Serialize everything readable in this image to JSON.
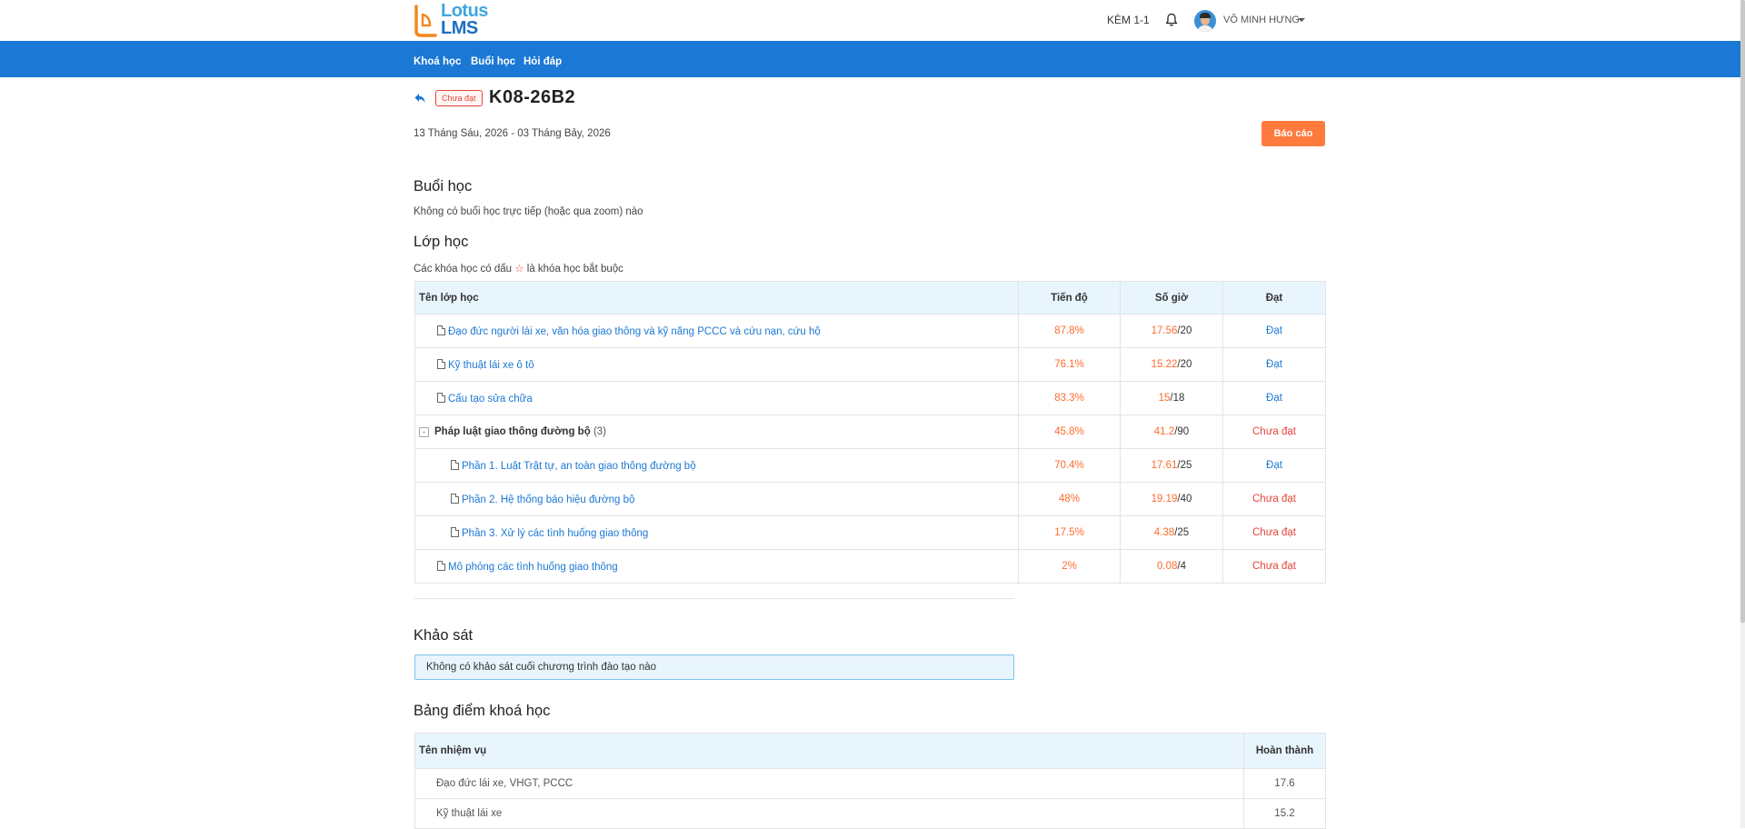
{
  "brand": {
    "line1": "Lotus",
    "line2": "LMS"
  },
  "header": {
    "org": "KÈM 1-1",
    "user_name": "VÕ MINH HƯNG"
  },
  "nav": {
    "items": [
      "Khoá học",
      "Buổi học",
      "Hỏi đáp"
    ]
  },
  "course": {
    "status_badge": "Chưa đạt",
    "title": "K08-26B2",
    "date_range": "13 Tháng Sáu, 2026 - 03 Tháng Bảy, 2026",
    "report_button": "Báo cáo"
  },
  "sessions": {
    "heading": "Buổi học",
    "empty_text": "Không có buổi học trực tiếp (hoặc qua zoom) nào"
  },
  "classes": {
    "heading": "Lớp học",
    "note_before": "Các khóa học có dấu",
    "note_star": "☆",
    "note_after": "là khóa học bắt buộc",
    "columns": [
      "Tên lớp học",
      "Tiến độ",
      "Số giờ",
      "Đạt"
    ],
    "rows": [
      {
        "name": "Đạo đức người lái xe, văn hóa giao thông và kỹ năng PCCC và cứu nạn, cứu hộ",
        "progress": "87.8%",
        "hours_done": "17.56",
        "hours_total": "/20",
        "status": "Đạt"
      },
      {
        "name": "Kỹ thuật lái xe ô tô",
        "progress": "76.1%",
        "hours_done": "15.22",
        "hours_total": "/20",
        "status": "Đạt"
      },
      {
        "name": "Cấu tạo sửa chữa",
        "progress": "83.3%",
        "hours_done": "15",
        "hours_total": "/18",
        "status": "Đạt"
      },
      {
        "name": "Pháp luật giao thông đường bộ",
        "count": "(3)",
        "toggle": "-",
        "progress": "45.8%",
        "hours_done": "41.2",
        "hours_total": "/90",
        "status": "Chưa đạt"
      },
      {
        "name": "Phần 1. Luật Trật tự, an toàn giao thông đường bộ",
        "progress": "70.4%",
        "hours_done": "17.61",
        "hours_total": "/25",
        "status": "Đạt"
      },
      {
        "name": "Phần 2. Hệ thống báo hiệu đường bộ",
        "progress": "48%",
        "hours_done": "19.19",
        "hours_total": "/40",
        "status": "Chưa đạt"
      },
      {
        "name": "Phần 3. Xử lý các tình huống giao thông",
        "progress": "17.5%",
        "hours_done": "4.38",
        "hours_total": "/25",
        "status": "Chưa đạt"
      },
      {
        "name": "Mô phỏng các tình huống giao thông",
        "progress": "2%",
        "hours_done": "0.08",
        "hours_total": "/4",
        "status": "Chưa đạt"
      }
    ]
  },
  "survey": {
    "heading": "Khảo sát",
    "empty_text": "Không có khảo sát cuối chương trình đào tạo nào"
  },
  "gradebook": {
    "heading": "Bảng điểm khoá học",
    "columns": [
      "Tên nhiệm vụ",
      "Hoàn thành"
    ],
    "rows": [
      {
        "task": "Đạo đức lái xe, VHGT, PCCC",
        "value": "17.6"
      },
      {
        "task": "Kỹ thuật lái xe",
        "value": "15.2"
      }
    ]
  },
  "colors": {
    "nav_bg": "#1b78d4",
    "accent_orange": "#ff7a3d",
    "fail_red": "#e4463a",
    "link_blue": "#1b78d4",
    "table_head_bg": "#e8f5fd"
  }
}
